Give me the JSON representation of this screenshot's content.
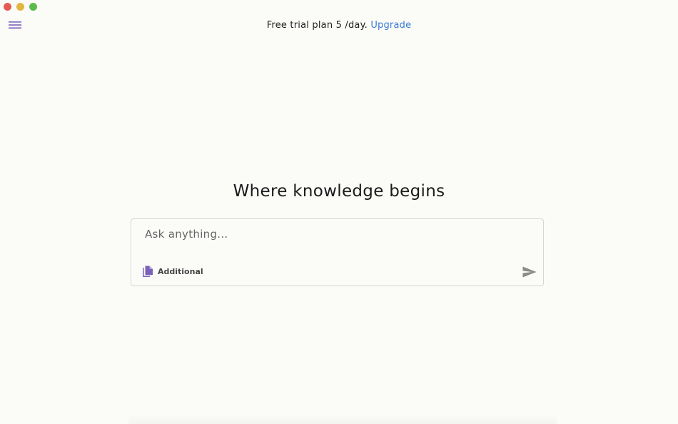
{
  "window": {
    "traffic_lights": {
      "close_color": "#e25c54",
      "minimize_color": "#e3b63f",
      "zoom_color": "#5cba4c"
    }
  },
  "header": {
    "menu_icon": "hamburger-menu-icon",
    "trial_text": "Free trial plan 5 /day.",
    "upgrade_label": "Upgrade"
  },
  "main": {
    "title": "Where knowledge begins",
    "search": {
      "placeholder": "Ask anything...",
      "value": ""
    },
    "additional_label": "Additional",
    "additional_icon": "copy-documents-icon",
    "send_icon": "send-icon"
  },
  "colors": {
    "accent_link": "#3a7bd5",
    "icon_purple": "#7b61b8",
    "background": "#fbfbf8"
  }
}
